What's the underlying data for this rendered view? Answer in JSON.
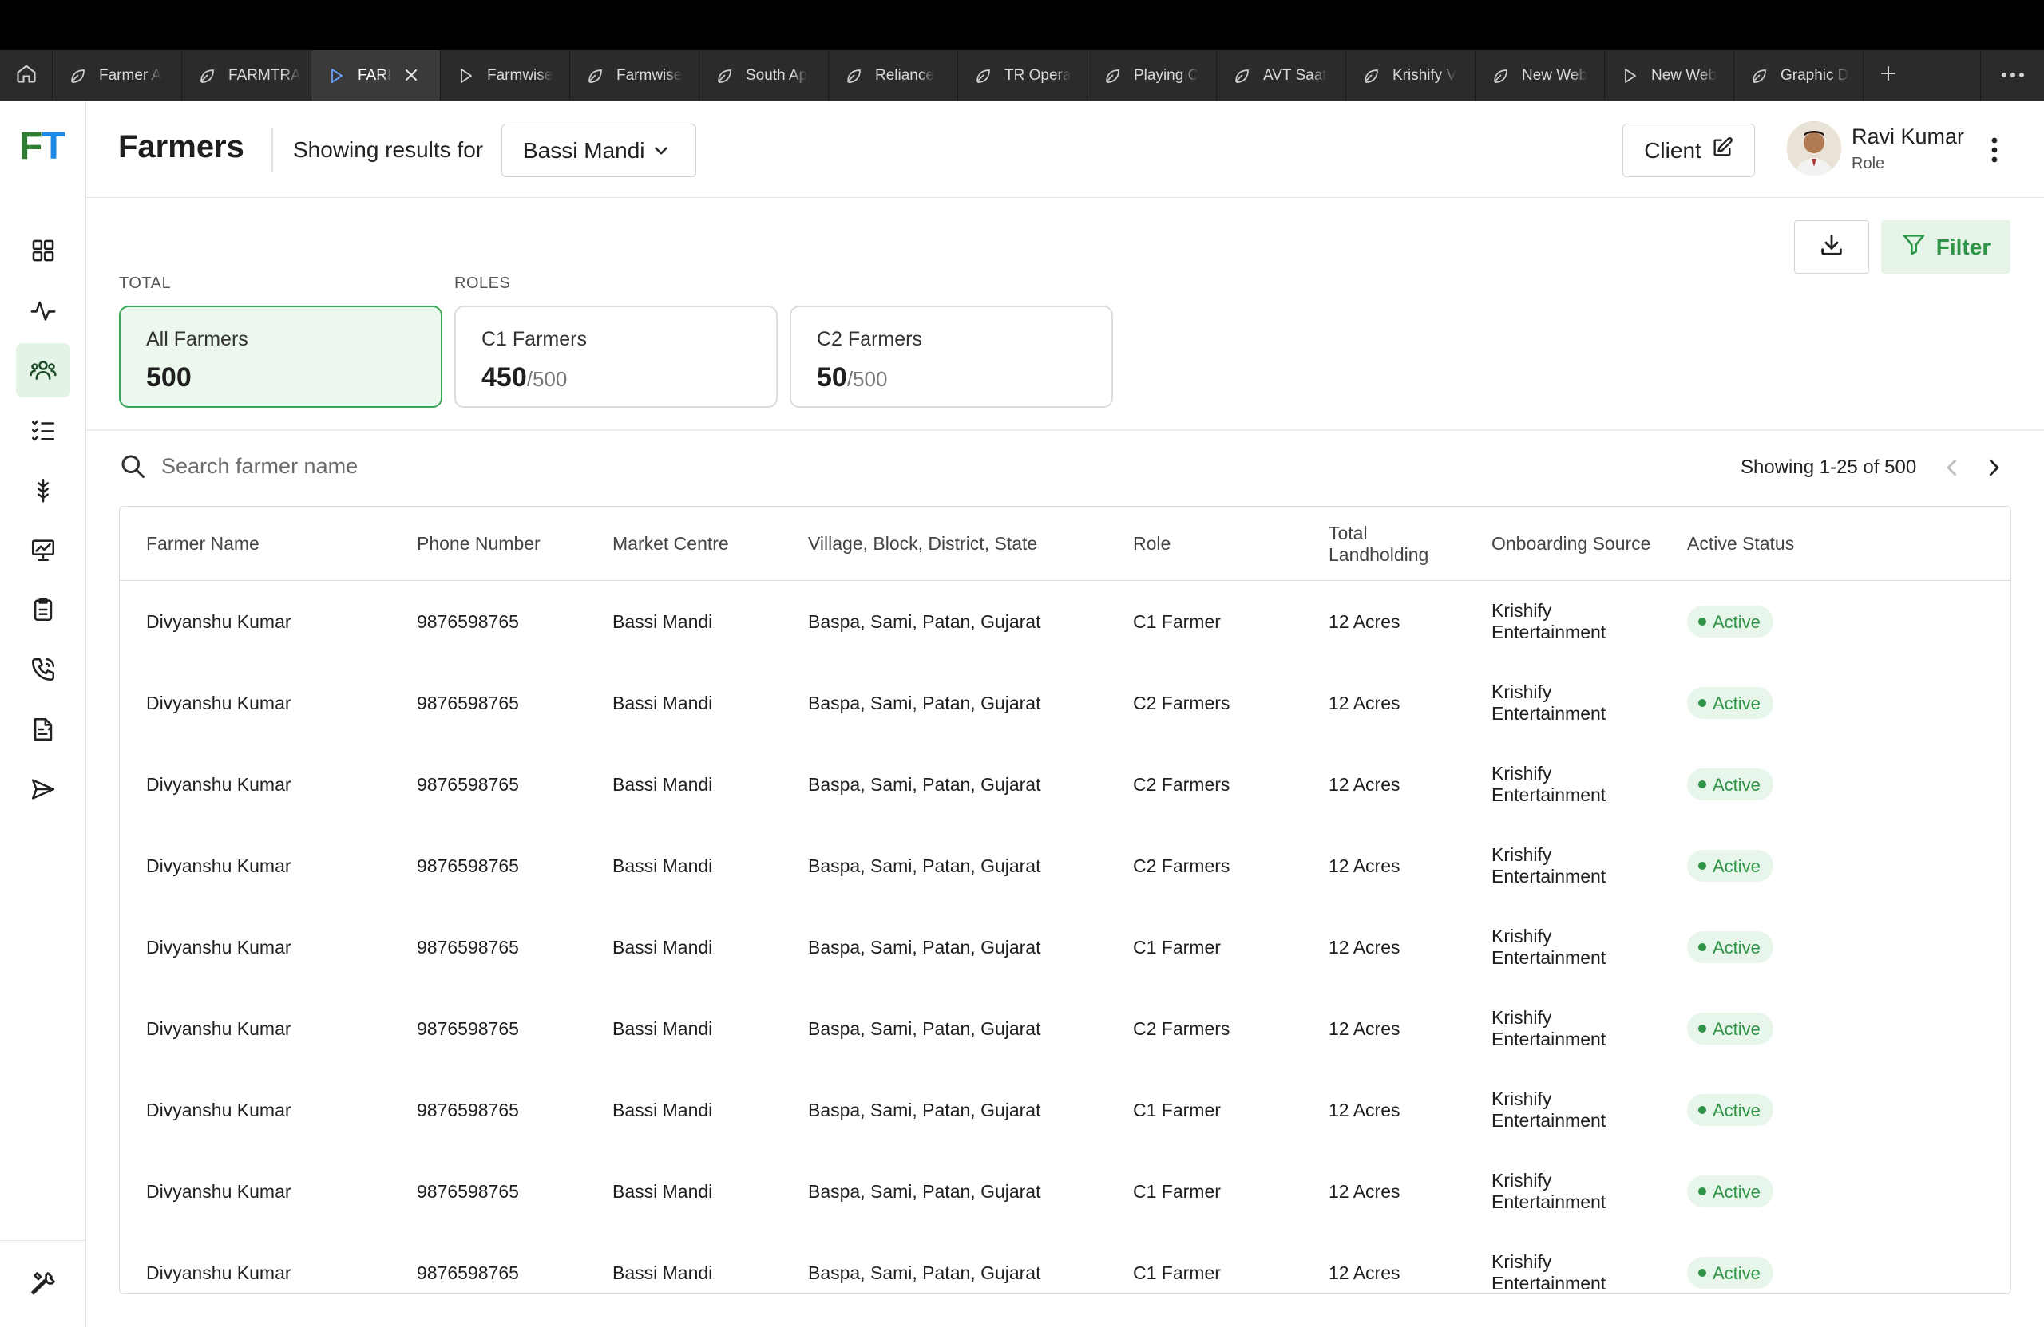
{
  "tabs": [
    {
      "label": "Farmer A",
      "icon": "leaf-icon"
    },
    {
      "label": "FARMTRA",
      "icon": "leaf-icon"
    },
    {
      "label": "FARI",
      "icon": "play-icon",
      "active": true
    },
    {
      "label": "Farmwise",
      "icon": "play-icon"
    },
    {
      "label": "Farmwise",
      "icon": "leaf-icon"
    },
    {
      "label": "South Ap",
      "icon": "leaf-icon"
    },
    {
      "label": "Reliance",
      "icon": "leaf-icon"
    },
    {
      "label": "TR Opera",
      "icon": "leaf-icon"
    },
    {
      "label": "Playing C",
      "icon": "leaf-icon"
    },
    {
      "label": "AVT Saat",
      "icon": "leaf-icon"
    },
    {
      "label": "Krishify V",
      "icon": "leaf-icon"
    },
    {
      "label": "New Web",
      "icon": "leaf-icon"
    },
    {
      "label": "New Web",
      "icon": "play-icon"
    },
    {
      "label": "Graphic D",
      "icon": "leaf-icon"
    }
  ],
  "sidebar": {
    "logo": {
      "f": "F",
      "t": "T"
    },
    "items": [
      "dashboard-icon",
      "activity-icon",
      "farmers-icon",
      "tasks-icon",
      "crop-icon",
      "presentation-icon",
      "clipboard-icon",
      "phone-icon",
      "reports-icon",
      "send-icon"
    ],
    "active_index": 2,
    "bottom": "tools-icon"
  },
  "header": {
    "title": "Farmers",
    "showing_label": "Showing results for",
    "location": "Bassi Mandi",
    "client_label": "Client",
    "user_name": "Ravi Kumar",
    "user_role": "Role"
  },
  "toolbar": {
    "filter_label": "Filter"
  },
  "summary": {
    "total_label": "TOTAL",
    "roles_label": "ROLES",
    "cards": [
      {
        "title": "All Farmers",
        "value": "500",
        "of": ""
      },
      {
        "title": "C1 Farmers",
        "value": "450",
        "of": "/500"
      },
      {
        "title": "C2 Farmers",
        "value": "50",
        "of": "/500"
      }
    ]
  },
  "search": {
    "placeholder": "Search farmer name"
  },
  "pagination": {
    "text": "Showing 1-25 of 500"
  },
  "table": {
    "columns": [
      "Farmer Name",
      "Phone Number",
      "Market Centre",
      "Village, Block, District, State",
      "Role",
      "Total Landholding",
      "Onboarding Source",
      "Active Status"
    ],
    "rows": [
      [
        "Divyanshu Kumar",
        "9876598765",
        "Bassi Mandi",
        "Baspa, Sami, Patan, Gujarat",
        "C1 Farmer",
        "12 Acres",
        "Krishify Entertainment",
        "Active"
      ],
      [
        "Divyanshu Kumar",
        "9876598765",
        "Bassi Mandi",
        "Baspa, Sami, Patan, Gujarat",
        "C2 Farmers",
        "12 Acres",
        "Krishify Entertainment",
        "Active"
      ],
      [
        "Divyanshu Kumar",
        "9876598765",
        "Bassi Mandi",
        "Baspa, Sami, Patan, Gujarat",
        "C2 Farmers",
        "12 Acres",
        "Krishify Entertainment",
        "Active"
      ],
      [
        "Divyanshu Kumar",
        "9876598765",
        "Bassi Mandi",
        "Baspa, Sami, Patan, Gujarat",
        "C2 Farmers",
        "12 Acres",
        "Krishify Entertainment",
        "Active"
      ],
      [
        "Divyanshu Kumar",
        "9876598765",
        "Bassi Mandi",
        "Baspa, Sami, Patan, Gujarat",
        "C1 Farmer",
        "12 Acres",
        "Krishify Entertainment",
        "Active"
      ],
      [
        "Divyanshu Kumar",
        "9876598765",
        "Bassi Mandi",
        "Baspa, Sami, Patan, Gujarat",
        "C2 Farmers",
        "12 Acres",
        "Krishify Entertainment",
        "Active"
      ],
      [
        "Divyanshu Kumar",
        "9876598765",
        "Bassi Mandi",
        "Baspa, Sami, Patan, Gujarat",
        "C1 Farmer",
        "12 Acres",
        "Krishify Entertainment",
        "Active"
      ],
      [
        "Divyanshu Kumar",
        "9876598765",
        "Bassi Mandi",
        "Baspa, Sami, Patan, Gujarat",
        "C1 Farmer",
        "12 Acres",
        "Krishify Entertainment",
        "Active"
      ],
      [
        "Divyanshu Kumar",
        "9876598765",
        "Bassi Mandi",
        "Baspa, Sami, Patan, Gujarat",
        "C1 Farmer",
        "12 Acres",
        "Krishify Entertainment",
        "Active"
      ]
    ]
  },
  "colors": {
    "accent": "#2e9446",
    "active_badge_bg": "#e8f5ea",
    "tabstrip": "#2b2b2b"
  }
}
